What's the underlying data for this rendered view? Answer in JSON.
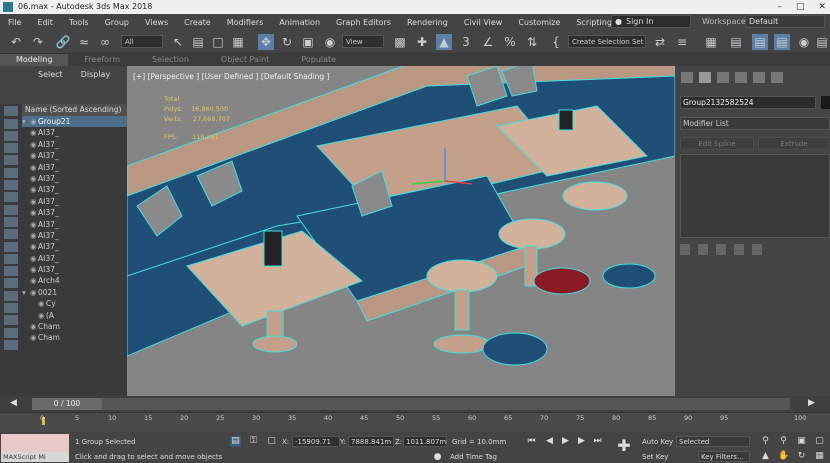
{
  "title": "06.max - Autodesk 3ds Max 2018",
  "menu": [
    "File",
    "Edit",
    "Tools",
    "Group",
    "Views",
    "Create",
    "Modifiers",
    "Animation",
    "Graph Editors",
    "Rendering",
    "Civil View",
    "Customize",
    "Scripting"
  ],
  "sign_in": "Sign In",
  "workspaces_label": "Workspaces:",
  "workspace_value": "Default",
  "toolbar": {
    "filter": "All",
    "view": "View",
    "selection_set": "Create Selection Set"
  },
  "ribbon_tabs": [
    "Modeling",
    "Freeform",
    "Selection",
    "Object Paint",
    "Populate"
  ],
  "left_panel": {
    "tabs": [
      "Select",
      "Display"
    ],
    "header": "Name (Sorted Ascending)",
    "rows": [
      "Group21",
      "AI37_",
      "AI37_",
      "AI37_",
      "AI37_",
      "AI37_",
      "AI37_",
      "AI37_",
      "AI37_",
      "AI37_",
      "AI37_",
      "AI37_",
      "AI37_",
      "AI37_",
      "Arch4",
      "0021",
      "Cy",
      "(A",
      "Cham",
      "Cham"
    ]
  },
  "viewport": {
    "label": "[+] [Perspective ] [User Defined ] [Default Shading ]",
    "stats_total": "Total",
    "polys_label": "Polys:",
    "polys_value": "16,860,500",
    "verts_label": "Verts:",
    "verts_value": "27,668,707",
    "fps_label": "FPS:",
    "fps_value": "116.281"
  },
  "right_panel": {
    "object_name": "Group2132582524",
    "modifier_list": "Modifier List",
    "edit_spline": "Edit Spline",
    "extrude": "Extrude"
  },
  "time_slider": "0 / 100",
  "track_labels": [
    "0",
    "5",
    "10",
    "15",
    "20",
    "25",
    "30",
    "35",
    "40",
    "45",
    "50",
    "55",
    "60",
    "65",
    "70",
    "75",
    "80",
    "85",
    "90",
    "95",
    "100"
  ],
  "status": {
    "maxscript": "MAXScript Mi",
    "selected": "1 Group Selected",
    "prompt": "Click and drag to select and move objects",
    "x_label": "X:",
    "x_value": "-15909.71",
    "y_label": "Y:",
    "y_value": "7888.841m",
    "z_label": "Z:",
    "z_value": "1011.807m",
    "grid": "Grid = 10.0mm",
    "add_time_tag": "Add Time Tag",
    "auto_key": "Auto Key",
    "set_key": "Set Key",
    "selected_dd": "Selected",
    "key_filters": "Key Filters..."
  }
}
